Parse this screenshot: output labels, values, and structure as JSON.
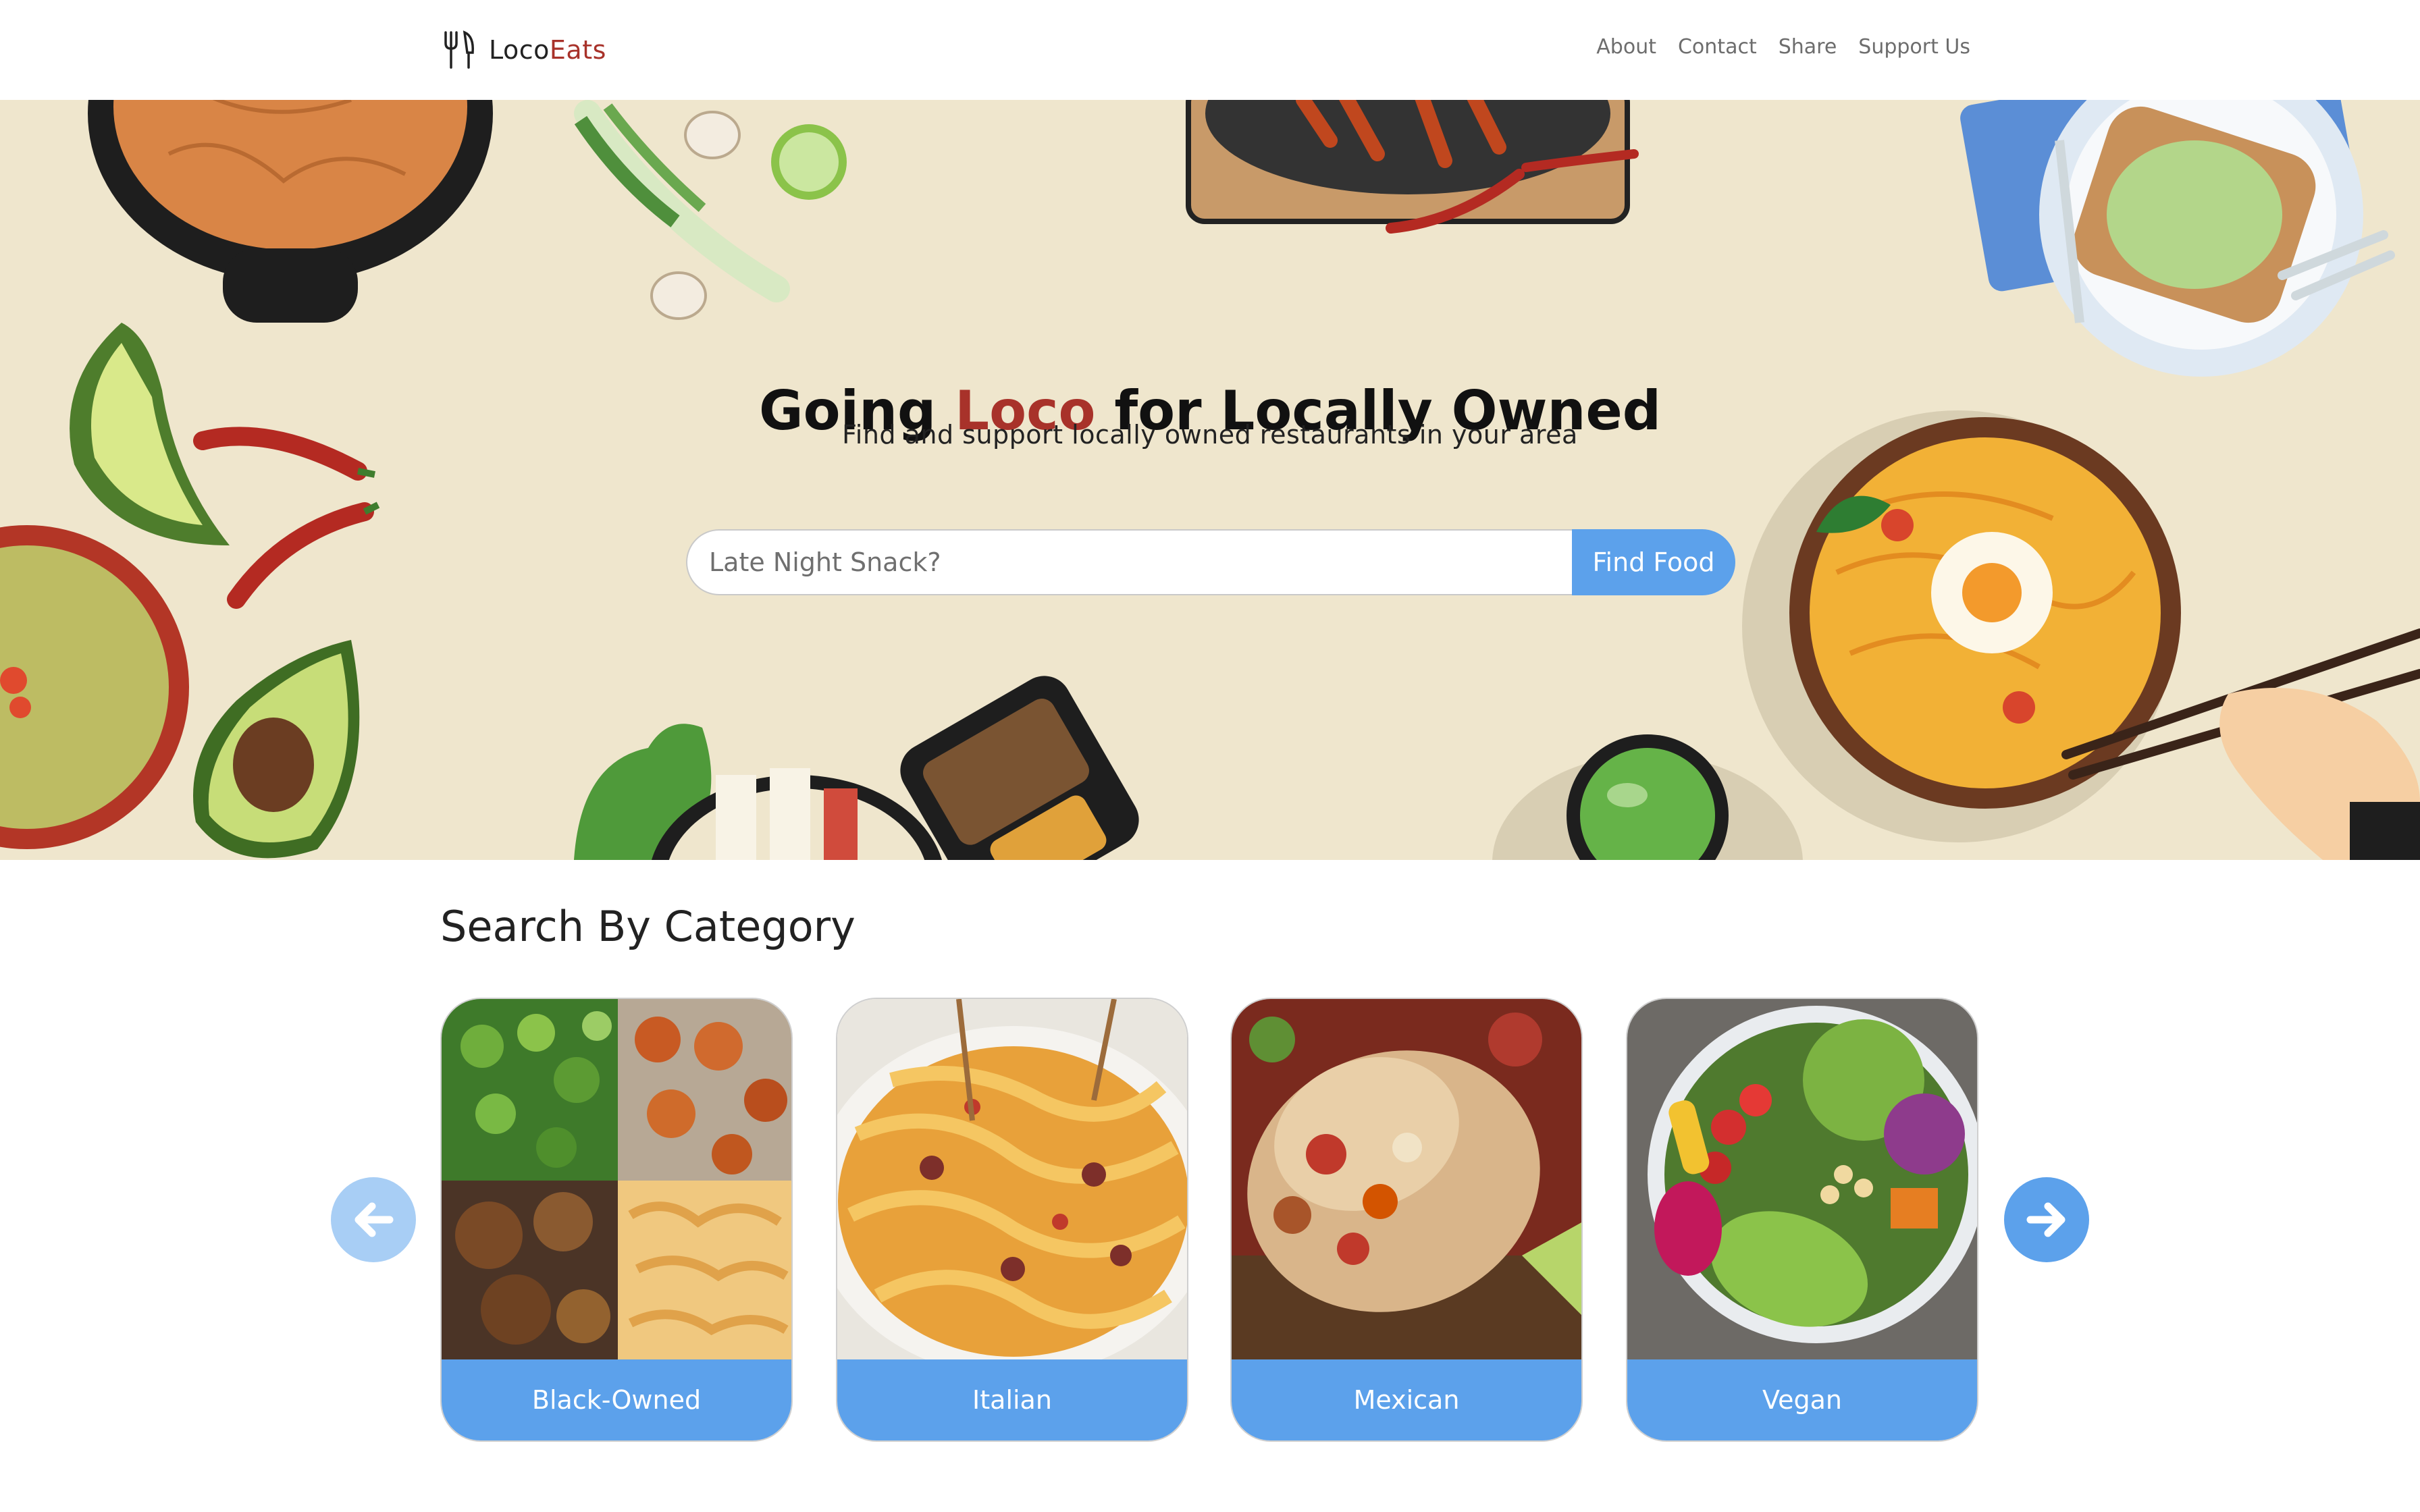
{
  "brand": {
    "name_part1": "Loco",
    "name_part2": "Eats"
  },
  "nav": {
    "items": [
      "About",
      "Contact",
      "Share",
      "Support Us"
    ]
  },
  "hero": {
    "title_before": "Going ",
    "title_accent": "Loco",
    "title_after": " for Locally Owned",
    "subtitle": "Find and support locally owned restaurants in your area",
    "search_placeholder": "Late Night Snack?",
    "search_button": "Find Food"
  },
  "categories": {
    "title": "Search By Category",
    "items": [
      {
        "label": "Black-Owned"
      },
      {
        "label": "Italian"
      },
      {
        "label": "Mexican"
      },
      {
        "label": "Vegan"
      }
    ]
  },
  "colors": {
    "accent": "#a8322a",
    "primary": "#5ca1eb",
    "hero_bg": "#efe6cd"
  },
  "icons": [
    "fork-knife-icon",
    "arrow-left-icon",
    "arrow-right-icon"
  ]
}
